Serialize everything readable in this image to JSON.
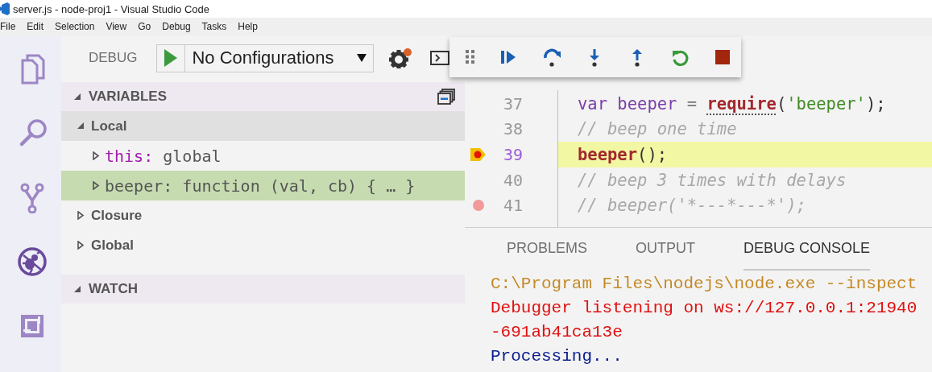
{
  "window": {
    "title": "server.js - node-proj1 - Visual Studio Code"
  },
  "menu": [
    "File",
    "Edit",
    "Selection",
    "View",
    "Go",
    "Debug",
    "Tasks",
    "Help"
  ],
  "activity_bar": [
    {
      "kind": "files",
      "selected": false
    },
    {
      "kind": "search",
      "selected": false
    },
    {
      "kind": "source-control",
      "selected": false
    },
    {
      "kind": "debug",
      "selected": true
    },
    {
      "kind": "extensions",
      "selected": false
    }
  ],
  "debug_header": {
    "label": "DEBUG",
    "configuration": "No Configurations",
    "settings_badge": true
  },
  "variables": {
    "title": "VARIABLES",
    "expanded": true,
    "scopes": [
      {
        "name": "Local",
        "expanded": true,
        "hovered": true,
        "children": [
          {
            "name": "this:",
            "value": "global",
            "kind": "keyword",
            "selected": false
          },
          {
            "name": "beeper:",
            "value": "function (val, cb) { … }",
            "kind": "plain",
            "selected": true
          }
        ]
      },
      {
        "name": "Closure",
        "expanded": false,
        "hovered": false
      },
      {
        "name": "Global",
        "expanded": false,
        "hovered": false
      }
    ]
  },
  "watch": {
    "title": "WATCH",
    "expanded": true
  },
  "debug_controls": [
    {
      "kind": "continue"
    },
    {
      "kind": "step-over"
    },
    {
      "kind": "step-into"
    },
    {
      "kind": "step-out"
    },
    {
      "kind": "restart"
    },
    {
      "kind": "stop"
    }
  ],
  "editor": {
    "lines": [
      {
        "number": "37",
        "current": false,
        "breakpoint": false,
        "tokens": [
          {
            "text": "var",
            "kind": "keyword"
          },
          {
            "text": " beeper",
            "kind": "variable"
          },
          {
            "text": " = ",
            "kind": "operator"
          },
          {
            "text": "require",
            "kind": "function",
            "hint": true
          },
          {
            "text": "(",
            "kind": "punct"
          },
          {
            "text": "'beeper'",
            "kind": "string"
          },
          {
            "text": ");",
            "kind": "punct"
          }
        ]
      },
      {
        "number": "38",
        "current": false,
        "breakpoint": false,
        "tokens": [
          {
            "text": "// beep one time",
            "kind": "comment"
          }
        ]
      },
      {
        "number": "39",
        "current": true,
        "breakpoint": true,
        "tokens": [
          {
            "text": "beeper",
            "kind": "function"
          },
          {
            "text": "();",
            "kind": "punct"
          }
        ]
      },
      {
        "number": "40",
        "current": false,
        "breakpoint": false,
        "tokens": [
          {
            "text": "// beep 3 times with delays",
            "kind": "comment"
          }
        ]
      },
      {
        "number": "41",
        "current": false,
        "breakpoint": true,
        "tokens": [
          {
            "text": "// beeper('*---*---*');",
            "kind": "comment"
          }
        ]
      }
    ]
  },
  "panel": {
    "tabs": [
      {
        "label": "PROBLEMS",
        "selected": false
      },
      {
        "label": "OUTPUT",
        "selected": false
      },
      {
        "label": "DEBUG CONSOLE",
        "selected": true
      }
    ],
    "console": [
      {
        "text": "C:\\Program Files\\nodejs\\node.exe --inspect",
        "kind": "command"
      },
      {
        "text": "Debugger listening on ws://127.0.0.1:21940",
        "kind": "error"
      },
      {
        "text": "-691ab41ca13e",
        "kind": "error"
      },
      {
        "text": "Processing...",
        "kind": "info"
      }
    ]
  }
}
